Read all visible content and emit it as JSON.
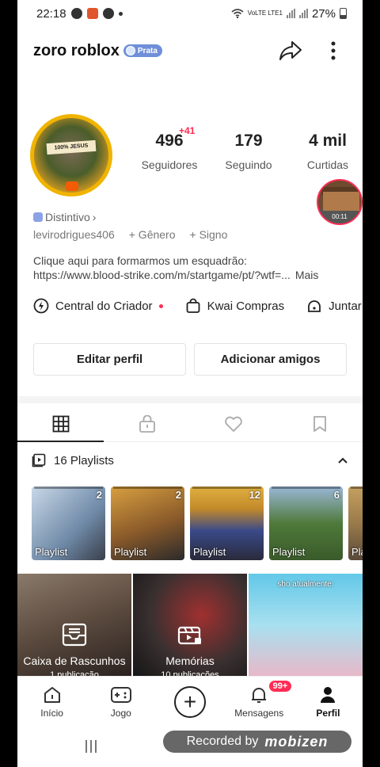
{
  "status_bar": {
    "time": "22:18",
    "network": "VoLTE LTE1",
    "battery": "27%"
  },
  "profile": {
    "username": "zoro roblox",
    "badge": "Prata",
    "avatar_banner": "100% JESUS",
    "stats": [
      {
        "value": "496",
        "label": "Seguidores",
        "delta": "+41"
      },
      {
        "value": "179",
        "label": "Seguindo"
      },
      {
        "value": "4 mil",
        "label": "Curtidas"
      }
    ],
    "video_duration": "00:11",
    "distintivo": "Distintivo",
    "handle": "levirodrigues406",
    "add_gender": "+ Gênero",
    "add_sign": "+ Signo",
    "bio_line1": "Clique aqui para formarmos um esquadrão:",
    "bio_line2": "https://www.blood-strike.com/m/startgame/pt/?wtf=...",
    "bio_more": "Mais"
  },
  "quick_links": [
    {
      "label": "Central do Criador",
      "icon": "lightbulb-icon"
    },
    {
      "label": "Kwai Compras",
      "icon": "shopping-bag-icon"
    },
    {
      "label": "Juntar",
      "icon": "bell-group-icon"
    }
  ],
  "buttons": {
    "edit_profile": "Editar perfil",
    "add_friends": "Adicionar amigos"
  },
  "tabs": [
    "grid-icon",
    "lock-icon",
    "heart-icon",
    "bookmark-icon"
  ],
  "playlists": {
    "title": "16 Playlists",
    "items": [
      {
        "count": "2",
        "label": "Playlist",
        "color": "#6f8aa8"
      },
      {
        "count": "2",
        "label": "Playlist",
        "color": "#8a5a2a"
      },
      {
        "count": "12",
        "label": "Playlist",
        "color": "#c48a2a"
      },
      {
        "count": "6",
        "label": "Playlist",
        "color": "#4f7a3a"
      },
      {
        "count": "",
        "label": "Pla",
        "color": "#9a7a4a"
      }
    ]
  },
  "grid": [
    {
      "title": "Caixa de Rascunhos",
      "subtitle": "1 publicação",
      "color": "#5b4a3e"
    },
    {
      "title": "Memórias",
      "subtitle": "10 publicações",
      "color": "#3a3030"
    },
    {
      "caption": "sho atualmente:",
      "color": "#62c8e8"
    }
  ],
  "bottom_nav": [
    {
      "label": "Início",
      "icon": "home-icon"
    },
    {
      "label": "Jogo",
      "icon": "gamepad-icon"
    },
    {
      "label": "",
      "icon": "plus-icon"
    },
    {
      "label": "Mensagens",
      "icon": "bell-icon",
      "badge": "99+"
    },
    {
      "label": "Perfil",
      "icon": "person-icon"
    }
  ],
  "recorder": {
    "text": "Recorded by",
    "brand": "mobizen"
  }
}
